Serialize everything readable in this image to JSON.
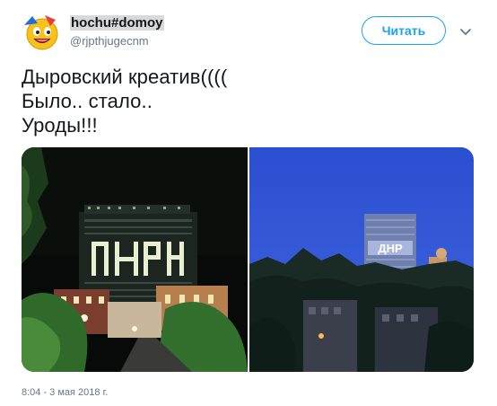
{
  "tweet": {
    "display_name": "hochu#domoy",
    "handle": "@rjpthjugecnm",
    "follow_label": "Читать",
    "text": "Дыровский креатив((((\nБыло.. стало..\nУроды!!!",
    "timestamp": "8:04 - 3 мая 2018 г.",
    "photo_right_sign": "ДНР"
  },
  "colors": {
    "accent": "#1da1f2",
    "secondary_text": "#657786",
    "primary_text": "#14171a"
  },
  "icons": {
    "avatar": "smiley-avatar-icon",
    "menu": "chevron-down-icon"
  }
}
